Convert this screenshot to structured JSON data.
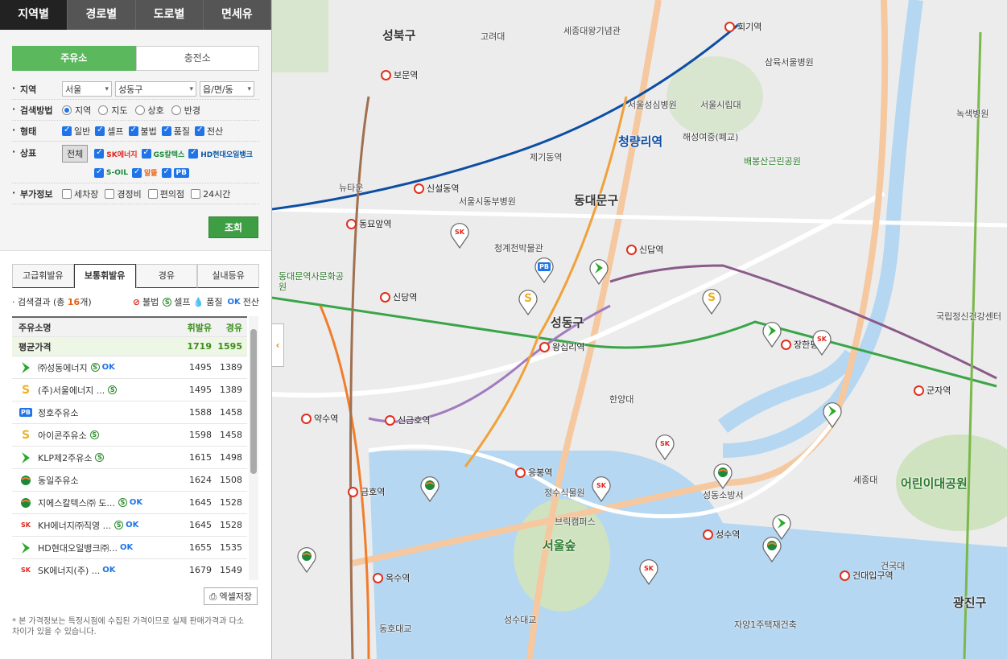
{
  "top_tabs": [
    "지역별",
    "경로별",
    "도로별",
    "면세유"
  ],
  "form": {
    "tabs": [
      "주유소",
      "충전소"
    ],
    "region": {
      "label": "지역",
      "sido": "서울",
      "gu": "성동구",
      "dong": "읍/면/동"
    },
    "method": {
      "label": "검색방법",
      "options": [
        "지역",
        "지도",
        "상호",
        "반경"
      ]
    },
    "type": {
      "label": "형태",
      "options": [
        "일반",
        "셀프",
        "불법",
        "품질",
        "전산"
      ]
    },
    "brand": {
      "label": "상표",
      "all": "전체",
      "items": [
        "SK에너지",
        "GS칼텍스",
        "HD현대오일뱅크",
        "S-OIL",
        "알뜰",
        "PB"
      ]
    },
    "extra": {
      "label": "부가정보",
      "options": [
        "세차장",
        "경정비",
        "편의점",
        "24시간"
      ]
    },
    "search_button": "조회"
  },
  "price_tabs": [
    "고급휘발유",
    "보통휘발유",
    "경유",
    "실내등유"
  ],
  "result": {
    "prefix": "검색결과 (총 ",
    "count": "16",
    "suffix": "개)",
    "legend": [
      "불법",
      "셀프",
      "품질",
      "전산"
    ]
  },
  "list": {
    "headers": [
      "주유소명",
      "휘발유",
      "경유"
    ],
    "average": {
      "name": "평균가격",
      "gas": "1719",
      "diesel": "1595"
    },
    "items": [
      {
        "name": "㈜성동에너지",
        "gas": "1495",
        "diesel": "1389",
        "brand": "HD",
        "self": true,
        "ok": true
      },
      {
        "name": "(주)서울에너지 ...",
        "gas": "1495",
        "diesel": "1389",
        "brand": "S-OIL",
        "self": true,
        "ok": false
      },
      {
        "name": "정호주유소",
        "gas": "1588",
        "diesel": "1458",
        "brand": "PB",
        "self": false,
        "ok": false
      },
      {
        "name": "아이콘주유소",
        "gas": "1598",
        "diesel": "1458",
        "brand": "S-OIL",
        "self": true,
        "ok": false
      },
      {
        "name": "KLP제2주유소",
        "gas": "1615",
        "diesel": "1498",
        "brand": "HD",
        "self": true,
        "ok": false
      },
      {
        "name": "동일주유소",
        "gas": "1624",
        "diesel": "1508",
        "brand": "GS",
        "self": false,
        "ok": false
      },
      {
        "name": "지에스칼텍스㈜ 도...",
        "gas": "1645",
        "diesel": "1528",
        "brand": "GS",
        "self": true,
        "ok": true
      },
      {
        "name": "KH에너지㈜직영 ...",
        "gas": "1645",
        "diesel": "1528",
        "brand": "SK",
        "self": true,
        "ok": true
      },
      {
        "name": "HD현대오일뱅크㈜...",
        "gas": "1655",
        "diesel": "1535",
        "brand": "HD",
        "self": false,
        "ok": true
      },
      {
        "name": "SK에너지(주) ...",
        "gas": "1679",
        "diesel": "1549",
        "brand": "SK",
        "self": false,
        "ok": true
      }
    ]
  },
  "excel_button": "엑셀저장",
  "note": "* 본 가격정보는 특정시점에 수집된 가격이므로 실제 판매가격과 다소 차이가 있을 수 있습니다.",
  "map": {
    "districts": [
      "성북구",
      "동대문구",
      "성동구",
      "광진구"
    ],
    "stations": [
      "회기역",
      "보문역",
      "신설동역",
      "동묘앞역",
      "신당역",
      "신답역",
      "왕십리역",
      "약수역",
      "신금호역",
      "금호역",
      "옥수역",
      "응봉역",
      "성수역",
      "건대입구역",
      "군자역",
      "장한평역"
    ],
    "places": [
      "청량리역",
      "고려대",
      "세종대왕기념관",
      "삼육서울병원",
      "서울시립대",
      "서울성심병원",
      "제기동역",
      "서울시동부병원",
      "청계천박물관",
      "한양대",
      "서울숲",
      "어린이대공원",
      "성동소방서",
      "정수식물원",
      "브릭캠퍼스",
      "동호대교",
      "성수대교",
      "녹색병원",
      "국립정신건강센터",
      "세종대",
      "건국대",
      "자양1주택재건축",
      "배봉산근린공원",
      "해성여중(폐교)",
      "동대문역사문화공원",
      "뉴타운"
    ]
  }
}
